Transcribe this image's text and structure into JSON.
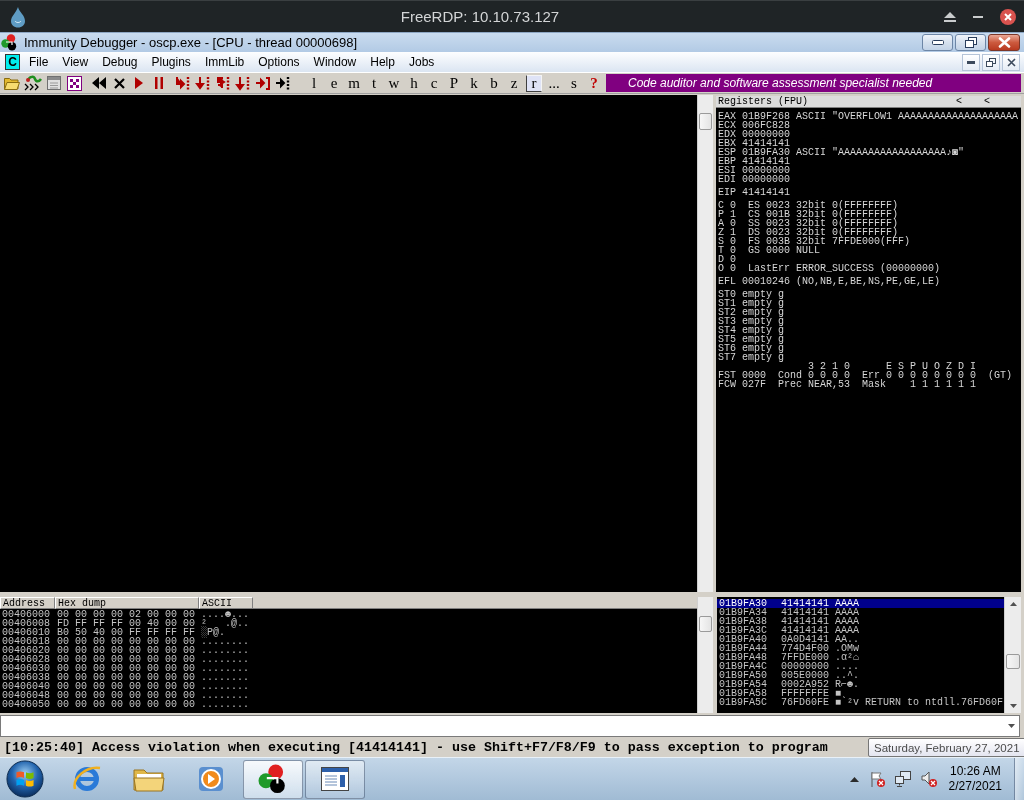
{
  "rdp": {
    "title": "FreeRDP: 10.10.73.127"
  },
  "window": {
    "title": "Immunity Debugger - oscp.exe - [CPU - thread 00000698]"
  },
  "menu": {
    "child_icon": "C",
    "items": [
      "File",
      "View",
      "Debug",
      "Plugins",
      "ImmLib",
      "Options",
      "Window",
      "Help",
      "Jobs"
    ]
  },
  "toolbar": {
    "letters": [
      {
        "label": "l",
        "selected": false
      },
      {
        "label": "e",
        "selected": false
      },
      {
        "label": "m",
        "selected": false
      },
      {
        "label": "t",
        "selected": false
      },
      {
        "label": "w",
        "selected": false
      },
      {
        "label": "h",
        "selected": false
      },
      {
        "label": "c",
        "selected": false
      },
      {
        "label": "P",
        "selected": false
      },
      {
        "label": "k",
        "selected": false
      },
      {
        "label": "b",
        "selected": false
      },
      {
        "label": "z",
        "selected": false
      },
      {
        "label": "r",
        "selected": true
      },
      {
        "label": "...",
        "selected": false
      },
      {
        "label": "s",
        "selected": false
      }
    ],
    "help": "?",
    "banner": "Code auditor and software assessment specialist needed"
  },
  "registers": {
    "title": "Registers (FPU)",
    "arrows": [
      "<",
      "<"
    ],
    "groups": [
      [
        "EAX 01B9F268 ASCII \"OVERFLOW1 AAAAAAAAAAAAAAAAAAAA",
        "ECX 006FC828",
        "EDX 00000000",
        "EBX 41414141",
        "ESP 01B9FA30 ASCII \"AAAAAAAAAAAAAAAAAA♪◙\"",
        "EBP 41414141",
        "ESI 00000000",
        "EDI 00000000"
      ],
      [
        "EIP 41414141"
      ],
      [
        "C 0  ES 0023 32bit 0(FFFFFFFF)",
        "P 1  CS 001B 32bit 0(FFFFFFFF)",
        "A 0  SS 0023 32bit 0(FFFFFFFF)",
        "Z 1  DS 0023 32bit 0(FFFFFFFF)",
        "S 0  FS 003B 32bit 7FFDE000(FFF)",
        "T 0  GS 0000 NULL",
        "D 0",
        "O 0  LastErr ERROR_SUCCESS (00000000)"
      ],
      [
        "EFL 00010246 (NO,NB,E,BE,NS,PE,GE,LE)"
      ]
    ],
    "fpu": {
      "stack": [
        "ST0 empty g",
        "ST1 empty g",
        "ST2 empty g",
        "ST3 empty g",
        "ST4 empty g",
        "ST5 empty g",
        "ST6 empty g",
        "ST7 empty g"
      ],
      "cond_header": "3 2 1 0",
      "error_header": "E S P U O Z D I",
      "status": "FST 0000  Cond 0 0 0 0  Err 0 0 0 0 0 0 0 0  (GT)",
      "control": "FCW 027F  Prec NEAR,53  Mask    1 1 1 1 1 1"
    }
  },
  "dump": {
    "columns": [
      "Address",
      "Hex dump",
      "ASCII"
    ],
    "rows": [
      {
        "address": "00406000",
        "hex": "00 00 00 00 02 00 00 00",
        "ascii": "....☻..."
      },
      {
        "address": "00406008",
        "hex": "FD FF FF FF 00 40 00 00",
        "ascii": "²   .@.."
      },
      {
        "address": "00406010",
        "hex": "B0 50 40 00 FF FF FF FF",
        "ascii": "░P@."
      },
      {
        "address": "00406018",
        "hex": "00 00 00 00 00 00 00 00",
        "ascii": "........"
      },
      {
        "address": "00406020",
        "hex": "00 00 00 00 00 00 00 00",
        "ascii": "........"
      },
      {
        "address": "00406028",
        "hex": "00 00 00 00 00 00 00 00",
        "ascii": "........"
      },
      {
        "address": "00406030",
        "hex": "00 00 00 00 00 00 00 00",
        "ascii": "........"
      },
      {
        "address": "00406038",
        "hex": "00 00 00 00 00 00 00 00",
        "ascii": "........"
      },
      {
        "address": "00406040",
        "hex": "00 00 00 00 00 00 00 00",
        "ascii": "........"
      },
      {
        "address": "00406048",
        "hex": "00 00 00 00 00 00 00 00",
        "ascii": "........"
      },
      {
        "address": "00406050",
        "hex": "00 00 00 00 00 00 00 00",
        "ascii": "........"
      }
    ]
  },
  "stack": {
    "rows": [
      {
        "address": "01B9FA30",
        "value": "41414141",
        "ascii": "AAAA",
        "selected": true
      },
      {
        "address": "01B9FA34",
        "value": "41414141",
        "ascii": "AAAA",
        "selected": false
      },
      {
        "address": "01B9FA38",
        "value": "41414141",
        "ascii": "AAAA",
        "selected": false
      },
      {
        "address": "01B9FA3C",
        "value": "41414141",
        "ascii": "AAAA",
        "selected": false
      },
      {
        "address": "01B9FA40",
        "value": "0A0D4141",
        "ascii": "AA..",
        "selected": false
      },
      {
        "address": "01B9FA44",
        "value": "774D4F00",
        "ascii": ".OMw",
        "selected": false
      },
      {
        "address": "01B9FA48",
        "value": "7FFDE000",
        "ascii": ".α²⌂",
        "selected": false
      },
      {
        "address": "01B9FA4C",
        "value": "00000000",
        "ascii": "....",
        "selected": false
      },
      {
        "address": "01B9FA50",
        "value": "005E0000",
        "ascii": "..^.",
        "selected": false
      },
      {
        "address": "01B9FA54",
        "value": "0002A952",
        "ascii": "R⌐☻.",
        "selected": false
      },
      {
        "address": "01B9FA58",
        "value": "FFFFFFFE",
        "ascii": "■",
        "selected": false
      },
      {
        "address": "01B9FA5C",
        "value": "76FD60FE",
        "ascii": "■`²v",
        "comment": "RETURN to ntdll.76FD60F",
        "selected": false
      }
    ]
  },
  "status": "[10:25:40] Access violation when executing [41414141] - use Shift+F7/F8/F9 to pass exception to program",
  "tooltip": "Saturday, February 27, 2021",
  "taskbar": {
    "apps": [
      {
        "running": false,
        "active": false
      },
      {
        "running": false,
        "active": false
      },
      {
        "running": false,
        "active": false
      },
      {
        "running": true,
        "active": true
      },
      {
        "running": true,
        "active": false
      }
    ],
    "clock": {
      "time": "10:26 AM",
      "date": "2/27/2021"
    }
  }
}
